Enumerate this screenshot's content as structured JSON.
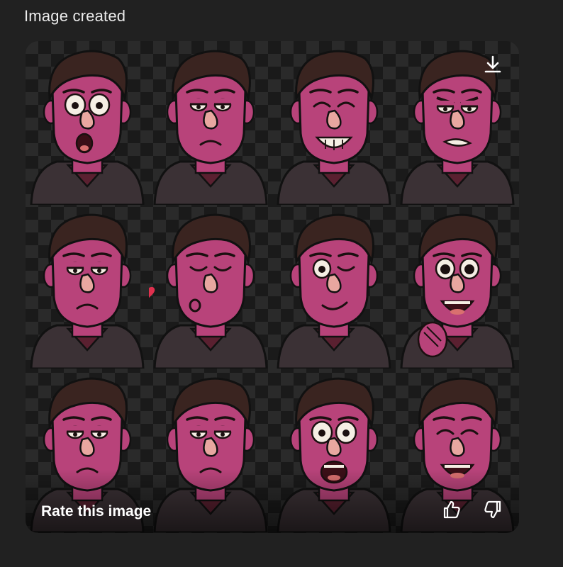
{
  "header": {
    "title": "Image created"
  },
  "image_card": {
    "rate_label": "Rate this image",
    "icons": {
      "download": "download-icon",
      "thumbs_up": "thumbs-up-icon",
      "thumbs_down": "thumbs-down-icon"
    },
    "stickers": [
      {
        "expression": "surprised"
      },
      {
        "expression": "sad"
      },
      {
        "expression": "grinning"
      },
      {
        "expression": "angry"
      },
      {
        "expression": "bored"
      },
      {
        "expression": "kissing"
      },
      {
        "expression": "winking"
      },
      {
        "expression": "excited"
      },
      {
        "expression": "unimpressed"
      },
      {
        "expression": "sleepy"
      },
      {
        "expression": "shocked"
      },
      {
        "expression": "laughing"
      }
    ]
  },
  "colors": {
    "page_background": "#212121",
    "skin": "#b8437a",
    "hair": "#3a2420",
    "hoodie": "#3b3135",
    "nose": "#e8a7a0",
    "heart": "#e0304e"
  }
}
